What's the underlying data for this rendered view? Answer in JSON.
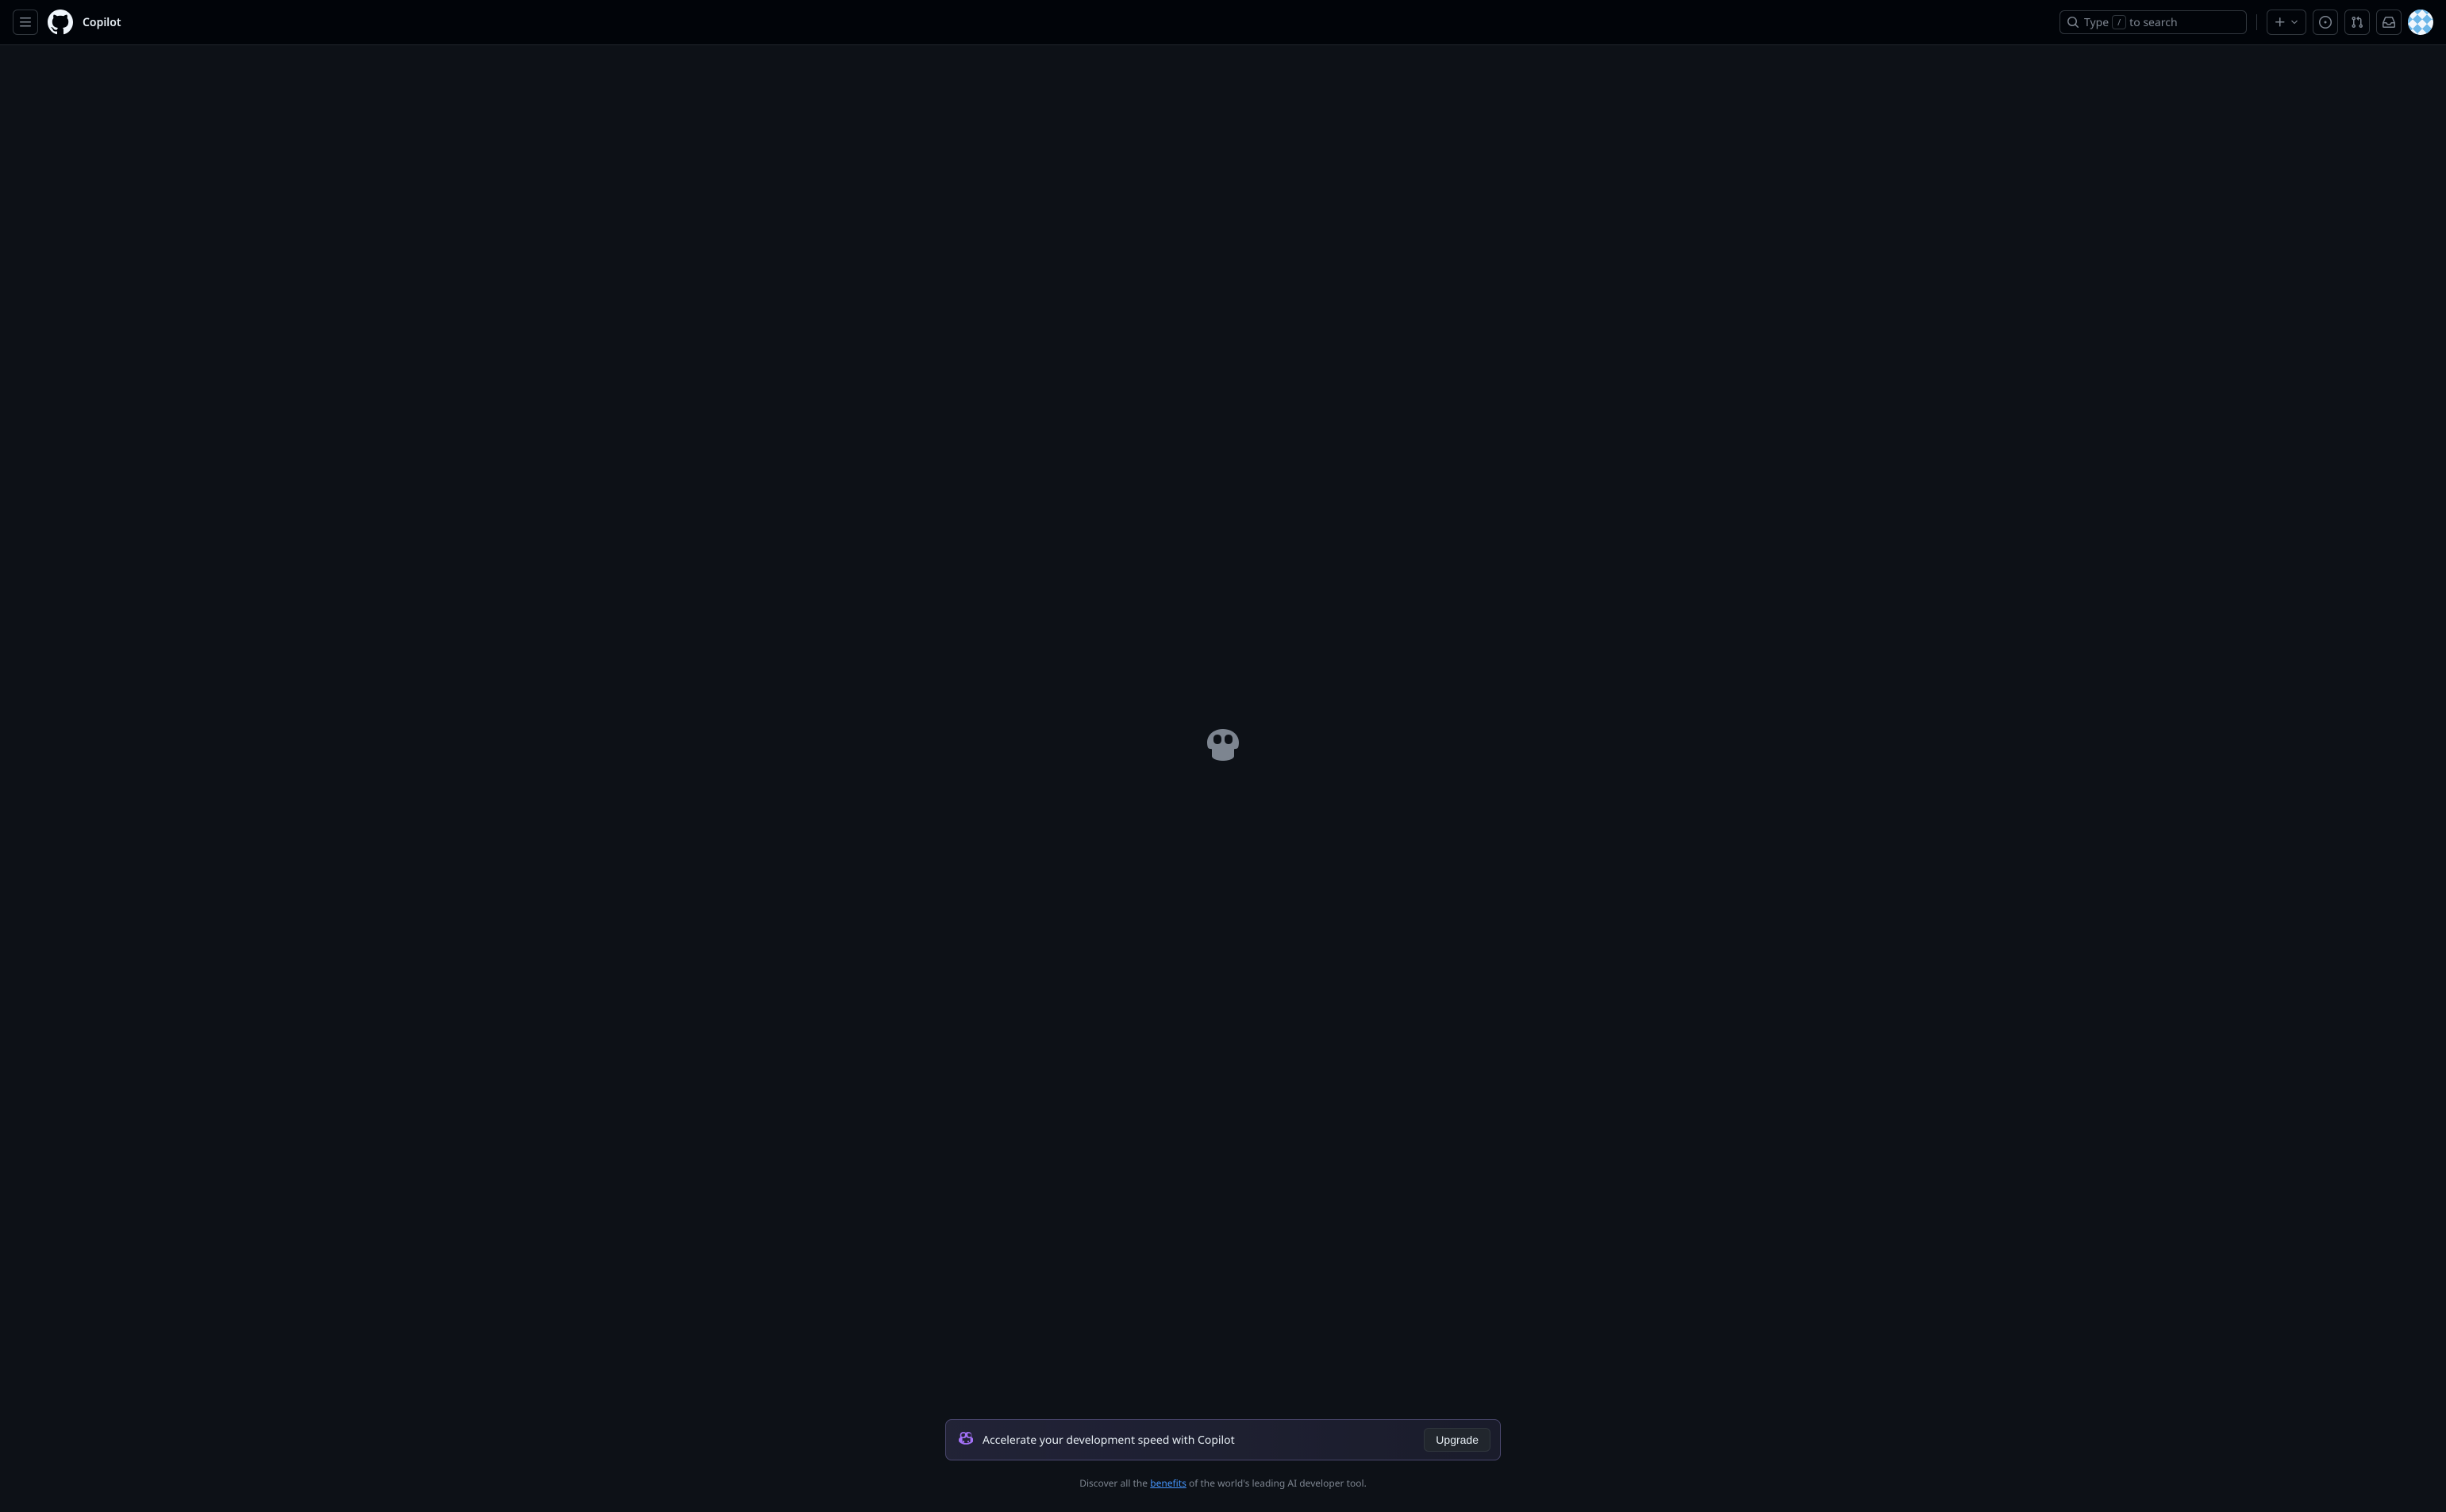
{
  "header": {
    "title": "Copilot",
    "search": {
      "type_label": "Type",
      "slash_key": "/",
      "search_label": "to search"
    }
  },
  "promo": {
    "text": "Accelerate your development speed with Copilot",
    "button_label": "Upgrade"
  },
  "discover": {
    "prefix": "Discover all the ",
    "link_text": "benefits",
    "suffix": " of the world's leading AI developer tool."
  }
}
